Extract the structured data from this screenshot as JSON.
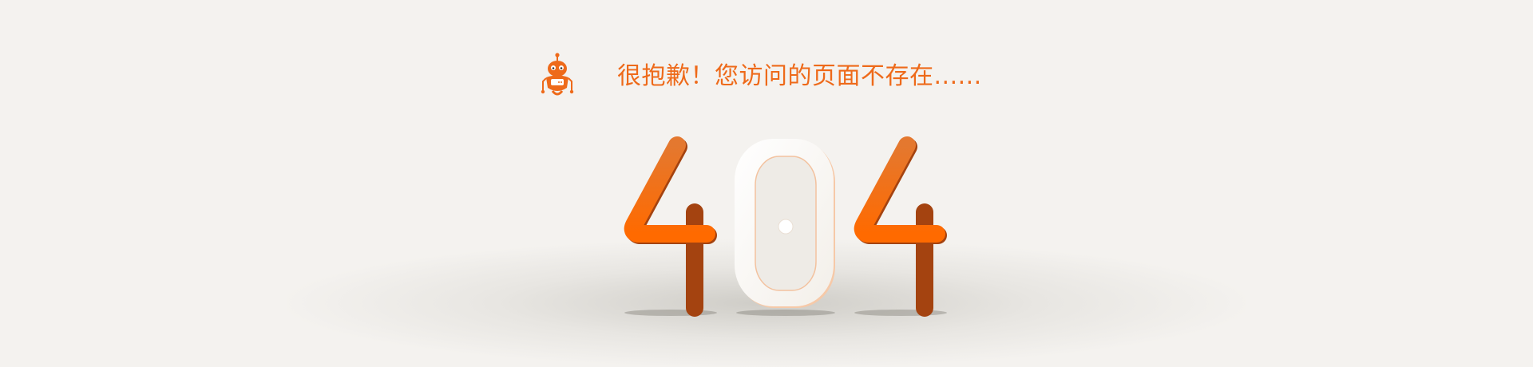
{
  "page": {
    "background_color": "#f4f2ef",
    "accent_color": "#ee6a1a"
  },
  "message": {
    "icon": "robot-icon",
    "text": "很抱歉！您访问的页面不存在......"
  },
  "error_code": {
    "digits": [
      "4",
      "0",
      "4"
    ],
    "digit_color": "#f27316",
    "zero_color": "#ffffff"
  }
}
